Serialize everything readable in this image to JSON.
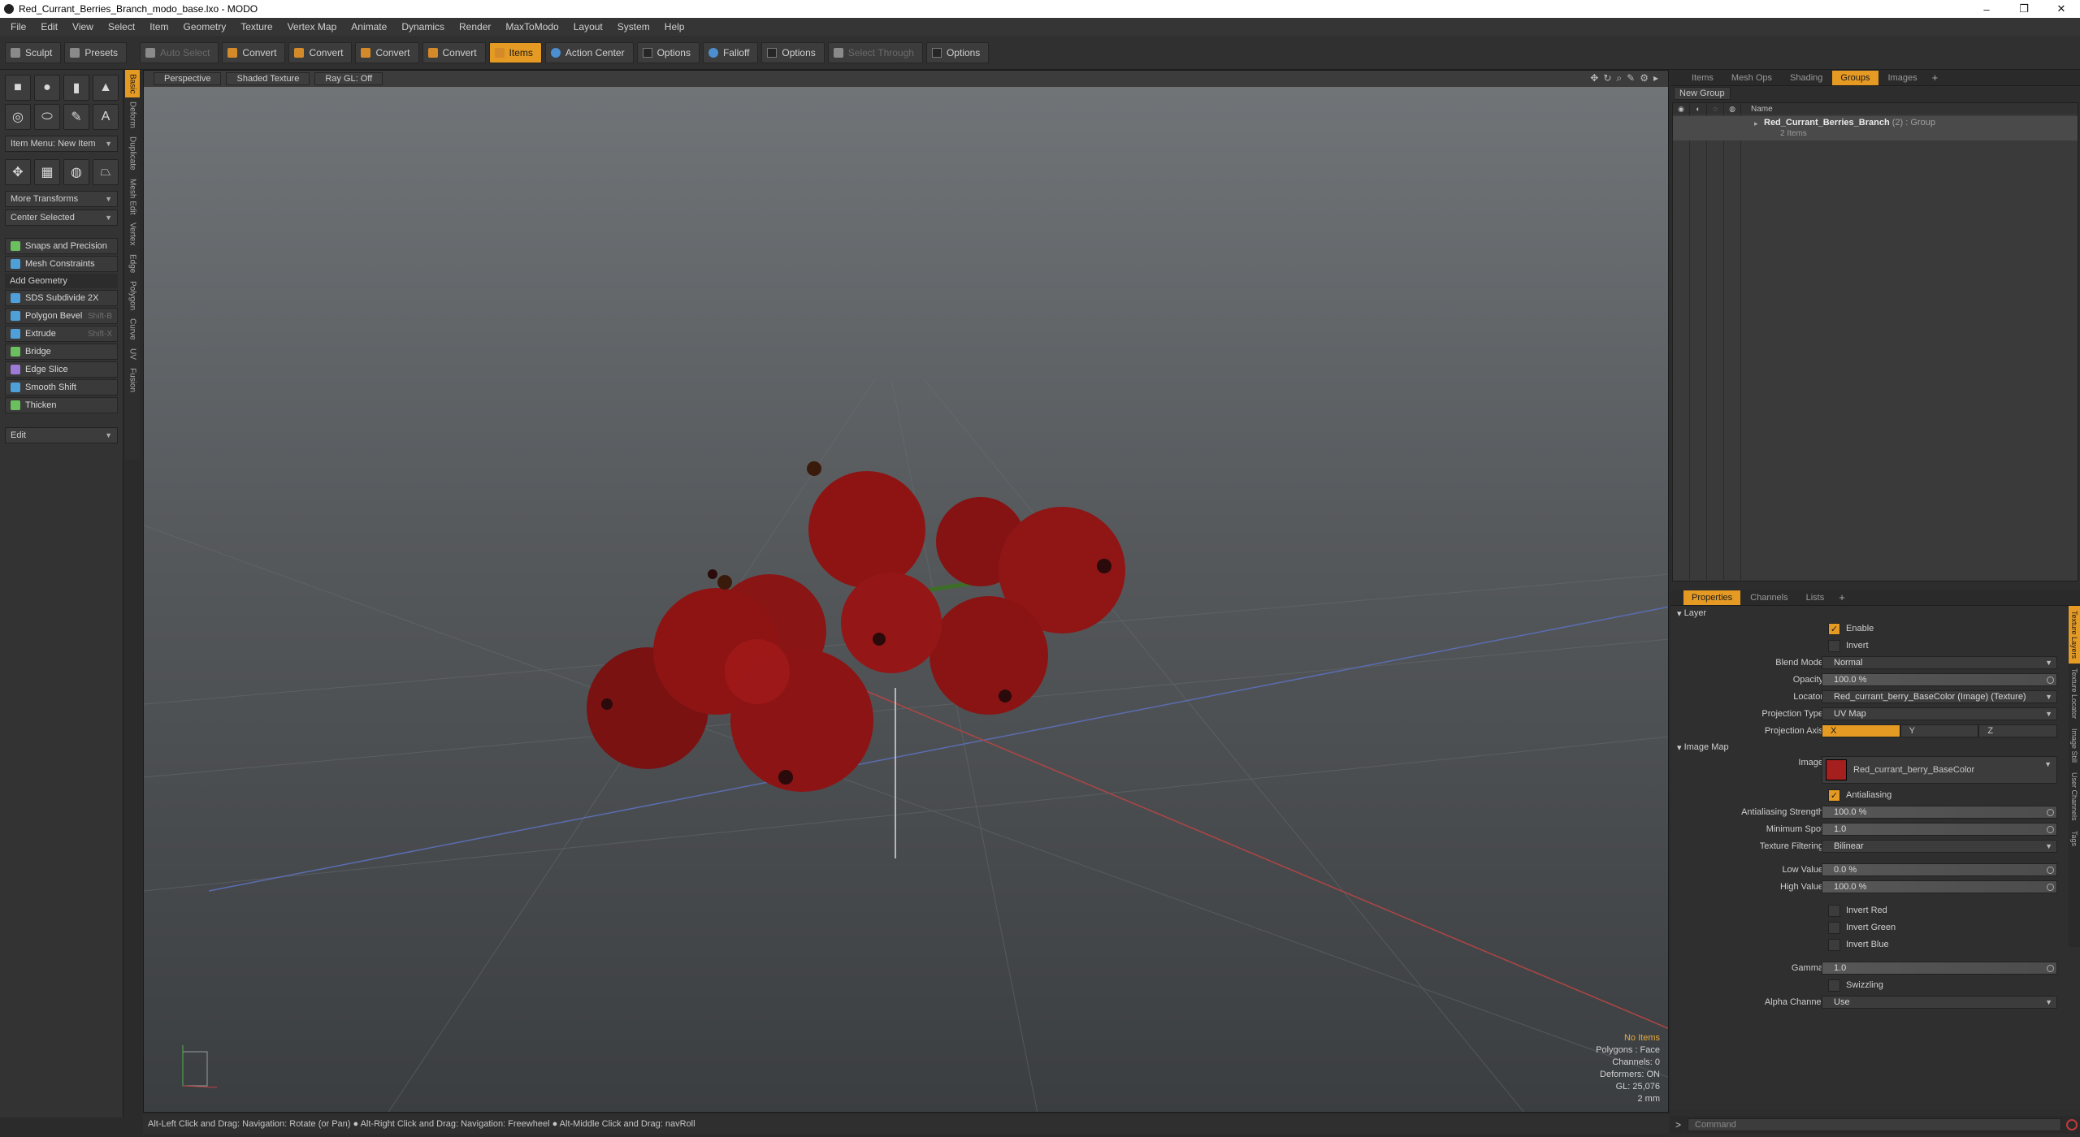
{
  "window": {
    "title": "Red_Currant_Berries_Branch_modo_base.lxo - MODO",
    "minimize": "–",
    "maximize": "❐",
    "close": "✕"
  },
  "menu": [
    "File",
    "Edit",
    "View",
    "Select",
    "Item",
    "Geometry",
    "Texture",
    "Vertex Map",
    "Animate",
    "Dynamics",
    "Render",
    "MaxToModo",
    "Layout",
    "System",
    "Help"
  ],
  "toolbar": {
    "sculpt": "Sculpt",
    "presets": "Presets",
    "auto_select": "Auto Select",
    "convert1": "Convert",
    "convert2": "Convert",
    "convert3": "Convert",
    "convert4": "Convert",
    "items": "Items",
    "action_center": "Action Center",
    "options1": "Options",
    "falloff": "Falloff",
    "options2": "Options",
    "select_through": "Select Through",
    "options3": "Options"
  },
  "left": {
    "item_menu": "Item Menu: New Item",
    "more_transforms": "More Transforms",
    "center_selected": "Center Selected",
    "snaps": "Snaps and Precision",
    "mesh_constraints": "Mesh Constraints",
    "add_geometry": "Add Geometry",
    "tools": [
      {
        "label": "SDS Subdivide 2X",
        "shortcut": ""
      },
      {
        "label": "Polygon Bevel",
        "shortcut": "Shift-B"
      },
      {
        "label": "Extrude",
        "shortcut": "Shift-X"
      },
      {
        "label": "Bridge",
        "shortcut": ""
      },
      {
        "label": "Edge Slice",
        "shortcut": ""
      },
      {
        "label": "Smooth Shift",
        "shortcut": ""
      },
      {
        "label": "Thicken",
        "shortcut": ""
      }
    ],
    "edit": "Edit",
    "vtabs": [
      "Basic",
      "Deform",
      "Duplicate",
      "Mesh Edit",
      "Vertex",
      "Edge",
      "Polygon",
      "Curve",
      "UV",
      "Fusion"
    ]
  },
  "viewport": {
    "perspective": "Perspective",
    "shaded": "Shaded Texture",
    "raygl": "Ray GL: Off",
    "info": {
      "no_items": "No Items",
      "polygons": "Polygons : Face",
      "channels": "Channels: 0",
      "deformers": "Deformers: ON",
      "gl": "GL: 25,076",
      "scale": "2 mm"
    }
  },
  "status": "Alt-Left Click and Drag: Navigation: Rotate (or Pan) ● Alt-Right Click and Drag: Navigation: Freewheel ● Alt-Middle Click and Drag: navRoll",
  "right_tabs": [
    "Items",
    "Mesh Ops",
    "Shading",
    "Groups",
    "Images"
  ],
  "groups": {
    "new_group": "New Group",
    "name_col": "Name",
    "row_name": "Red_Currant_Berries_Branch",
    "row_count": "(2)",
    "row_type": ": Group",
    "row_sub": "2 Items"
  },
  "props_tabs": [
    "Properties",
    "Channels",
    "Lists"
  ],
  "props": {
    "layer": "Layer",
    "enable": "Enable",
    "invert": "Invert",
    "blend_mode_label": "Blend Mode",
    "blend_mode": "Normal",
    "opacity_label": "Opacity",
    "opacity": "100.0 %",
    "locator_label": "Locator",
    "locator": "Red_currant_berry_BaseColor (Image) (Texture)",
    "proj_type_label": "Projection Type",
    "proj_type": "UV Map",
    "proj_axis_label": "Projection Axis",
    "axis_x": "X",
    "axis_y": "Y",
    "axis_z": "Z",
    "image_map": "Image Map",
    "image_label": "Image",
    "image": "Red_currant_berry_BaseColor",
    "antialiasing": "Antialiasing",
    "aa_strength_label": "Antialiasing Strength",
    "aa_strength": "100.0 %",
    "min_spot_label": "Minimum Spot",
    "min_spot": "1.0",
    "tex_filter_label": "Texture Filtering",
    "tex_filter": "Bilinear",
    "low_label": "Low Value",
    "low": "0.0 %",
    "high_label": "High Value",
    "high": "100.0 %",
    "invert_red": "Invert Red",
    "invert_green": "Invert Green",
    "invert_blue": "Invert Blue",
    "gamma_label": "Gamma",
    "gamma": "1.0",
    "swizzling": "Swizzling",
    "alpha_label": "Alpha Channel",
    "alpha": "Use"
  },
  "props_vtabs": [
    "Texture Layers",
    "Texture Locator",
    "Image Still",
    "User Channels",
    "Tags"
  ],
  "command_placeholder": "Command",
  "colors": {
    "accent": "#e59a23",
    "berry": "#8e1414"
  }
}
